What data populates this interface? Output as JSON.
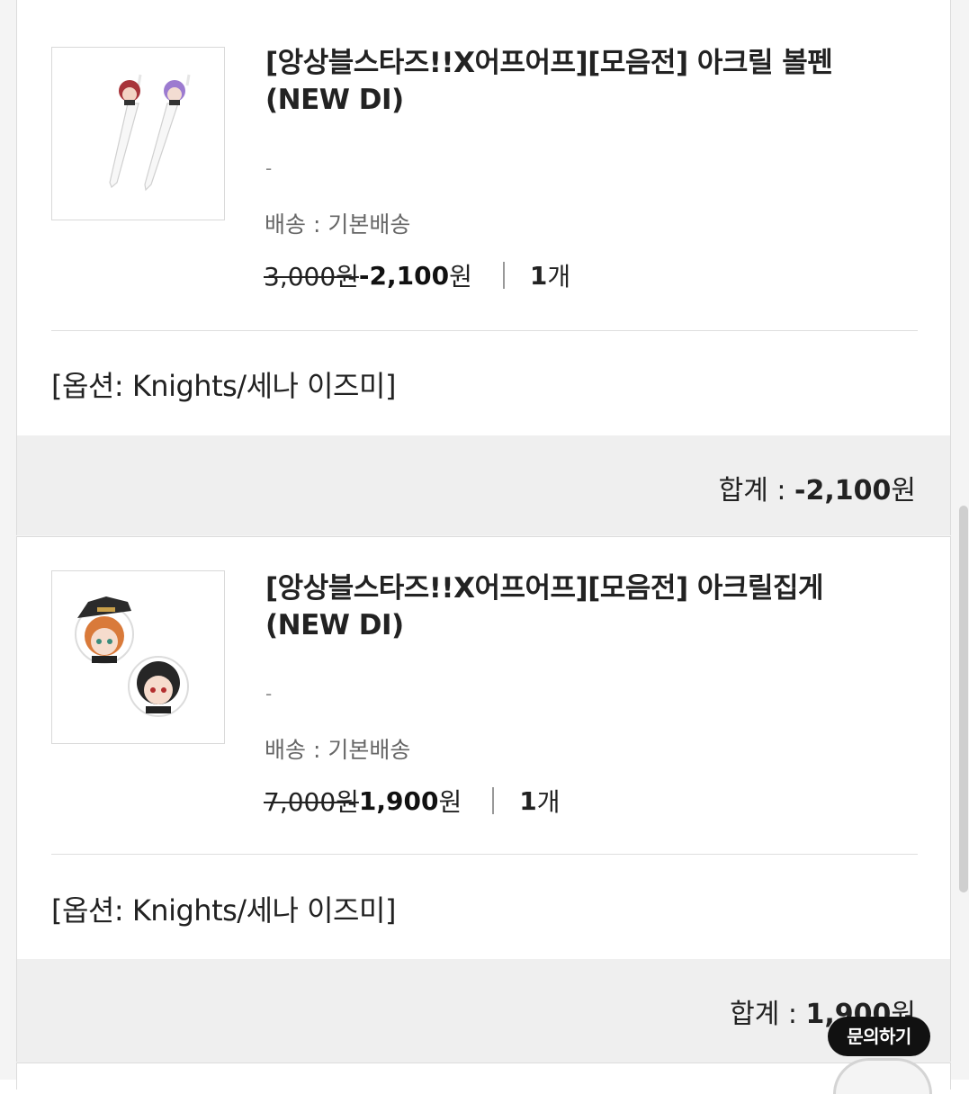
{
  "items": [
    {
      "title": "[앙상블스타즈!!X어프어프][모음전] 아크릴 볼펜 (NEW DI)",
      "dash": "-",
      "shipping": "배송 : 기본배송",
      "old_price": "3,000원",
      "new_price_num": "-2,100",
      "new_price_unit": "원",
      "qty_num": "1",
      "qty_unit": "개",
      "option": "[옵션: Knights/세나 이즈미]",
      "total_label": "합계 : ",
      "total_num": "-2,100",
      "total_unit": "원",
      "image_icon": "acrylic-ballpen-image"
    },
    {
      "title": "[앙상블스타즈!!X어프어프][모음전] 아크릴집게 (NEW DI)",
      "dash": "-",
      "shipping": "배송 : 기본배송",
      "old_price": "7,000원",
      "new_price_num": "1,900",
      "new_price_unit": "원",
      "qty_num": "1",
      "qty_unit": "개",
      "option": "[옵션: Knights/세나 이즈미]",
      "total_label": "합계 : ",
      "total_num": "1,900",
      "total_unit": "원",
      "image_icon": "acrylic-clip-image"
    }
  ],
  "inquiry": {
    "label": "문의하기",
    "icon": "chat-character-icon"
  },
  "colors": {
    "background": "#f4f4f4",
    "card": "#ffffff",
    "total_bar": "#efefef",
    "text": "#222222",
    "muted": "#666666"
  }
}
